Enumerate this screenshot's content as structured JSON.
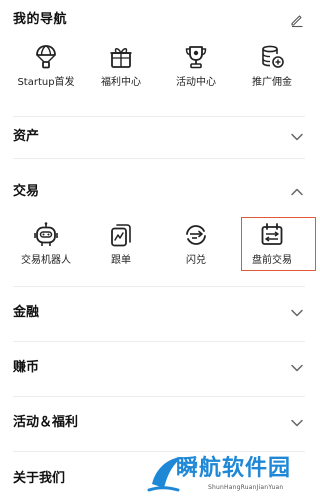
{
  "my_nav": {
    "title": "我的导航",
    "edit_icon": "pencil-icon",
    "items": [
      {
        "label": "Startup首发",
        "icon": "parachute-icon"
      },
      {
        "label": "福利中心",
        "icon": "gift-icon"
      },
      {
        "label": "活动中心",
        "icon": "trophy-icon"
      },
      {
        "label": "推广佣金",
        "icon": "coins-icon"
      }
    ]
  },
  "sections": {
    "assets": {
      "title": "资产",
      "expanded": false
    },
    "trade": {
      "title": "交易",
      "expanded": true,
      "items": [
        {
          "label": "交易机器人",
          "icon": "robot-icon"
        },
        {
          "label": "跟单",
          "icon": "copy-trade-icon"
        },
        {
          "label": "闪兑",
          "icon": "swap-icon"
        },
        {
          "label": "盘前交易",
          "icon": "premarket-icon",
          "highlighted": true
        }
      ]
    },
    "finance": {
      "title": "金融",
      "expanded": false
    },
    "earn": {
      "title": "赚币",
      "expanded": false
    },
    "activity_welfare": {
      "title": "活动＆福利",
      "expanded": false
    },
    "about": {
      "title": "关于我们",
      "expanded": false
    }
  },
  "colors": {
    "text": "#111111",
    "divider": "#ececec",
    "highlight": "#e05a3a",
    "watermark": "#1e88d6"
  },
  "watermark": {
    "text": "瞬航软件园",
    "sub": "ShunHangRuanJianYuan"
  }
}
